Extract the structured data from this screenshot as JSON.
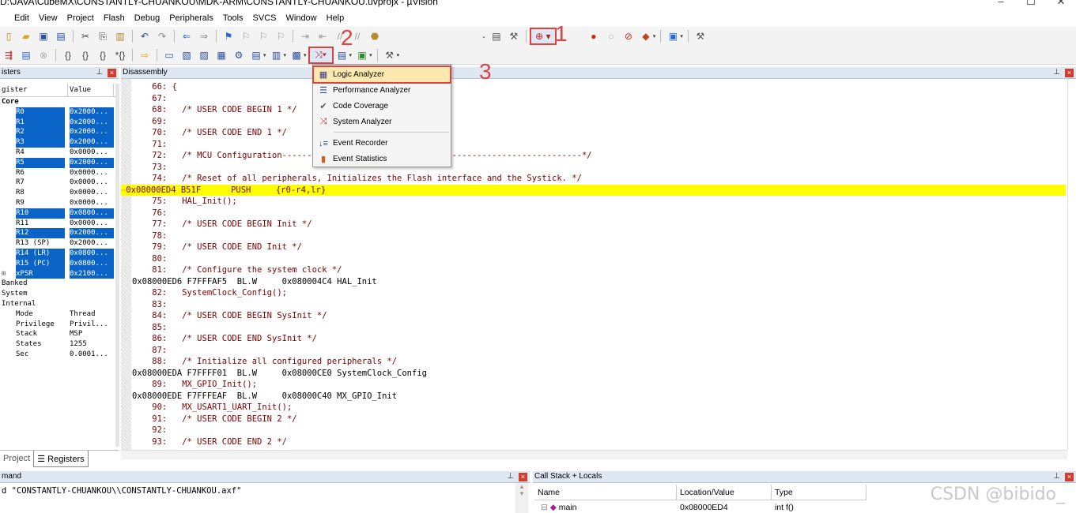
{
  "window": {
    "title": "D:\\JAVA\\CubeMX\\CONSTANTLY-CHUANKOU\\MDK-ARM\\CONSTANTLY-CHUANKOU.uvprojx - µVision",
    "minimize": "–",
    "maximize": "☐",
    "close": "✕"
  },
  "menu": [
    "Edit",
    "View",
    "Project",
    "Flash",
    "Debug",
    "Peripherals",
    "Tools",
    "SVCS",
    "Window",
    "Help"
  ],
  "annotations": {
    "one": "1",
    "two": "2",
    "three": "3"
  },
  "colors": {
    "highlight": "#ffff00",
    "selection": "#0a64c8",
    "annotation": "#e04040"
  },
  "registers_panel": {
    "title": "isters",
    "col_register": "gister",
    "col_value": "Value",
    "rows": [
      {
        "name": "Core",
        "value": "",
        "selected": false,
        "indent": 0,
        "bold": true
      },
      {
        "name": "R0",
        "value": "0x2000...",
        "selected": true,
        "indent": 1
      },
      {
        "name": "R1",
        "value": "0x2000...",
        "selected": true,
        "indent": 1
      },
      {
        "name": "R2",
        "value": "0x2000...",
        "selected": true,
        "indent": 1
      },
      {
        "name": "R3",
        "value": "0x2000...",
        "selected": true,
        "indent": 1
      },
      {
        "name": "R4",
        "value": "0x0000...",
        "selected": false,
        "indent": 1
      },
      {
        "name": "R5",
        "value": "0x2000...",
        "selected": true,
        "indent": 1
      },
      {
        "name": "R6",
        "value": "0x0000...",
        "selected": false,
        "indent": 1
      },
      {
        "name": "R7",
        "value": "0x0000...",
        "selected": false,
        "indent": 1
      },
      {
        "name": "R8",
        "value": "0x0000...",
        "selected": false,
        "indent": 1
      },
      {
        "name": "R9",
        "value": "0x0000...",
        "selected": false,
        "indent": 1
      },
      {
        "name": "R10",
        "value": "0x0800...",
        "selected": true,
        "indent": 1
      },
      {
        "name": "R11",
        "value": "0x0000...",
        "selected": false,
        "indent": 1
      },
      {
        "name": "R12",
        "value": "0x2000...",
        "selected": true,
        "indent": 1
      },
      {
        "name": "R13 (SP)",
        "value": "0x2000...",
        "selected": false,
        "indent": 1
      },
      {
        "name": "R14 (LR)",
        "value": "0x0800...",
        "selected": true,
        "indent": 1
      },
      {
        "name": "R15 (PC)",
        "value": "0x0800...",
        "selected": true,
        "indent": 1
      },
      {
        "name": "xPSR",
        "value": "0x2100...",
        "selected": true,
        "indent": 1,
        "expander": "⊞"
      },
      {
        "name": "Banked",
        "value": "",
        "selected": false,
        "indent": 0
      },
      {
        "name": "System",
        "value": "",
        "selected": false,
        "indent": 0
      },
      {
        "name": "Internal",
        "value": "",
        "selected": false,
        "indent": 0
      },
      {
        "name": "Mode",
        "value": "Thread",
        "selected": false,
        "indent": 1
      },
      {
        "name": "Privilege",
        "value": "Privil...",
        "selected": false,
        "indent": 1
      },
      {
        "name": "Stack",
        "value": "MSP",
        "selected": false,
        "indent": 1
      },
      {
        "name": "States",
        "value": "1255",
        "selected": false,
        "indent": 1
      },
      {
        "name": "Sec",
        "value": "0.0001...",
        "selected": false,
        "indent": 1
      }
    ],
    "tab_project": "Project",
    "tab_registers": "Registers"
  },
  "disassembly": {
    "title": "Disassembly",
    "lines": [
      {
        "kind": "src",
        "text": "    66: {"
      },
      {
        "kind": "src",
        "text": "    67: "
      },
      {
        "kind": "src",
        "text": "    68:   /* USER CODE BEGIN 1 */"
      },
      {
        "kind": "src",
        "text": "    69: "
      },
      {
        "kind": "src",
        "text": "    70:   /* USER CODE END 1 */"
      },
      {
        "kind": "src",
        "text": "    71: "
      },
      {
        "kind": "src",
        "text": "    72:   /* MCU Configuration------------------------------------------------------------*/"
      },
      {
        "kind": "src",
        "text": "    73: "
      },
      {
        "kind": "src",
        "text": "    74:   /* Reset of all peripherals, Initializes the Flash interface and the Systick. */"
      },
      {
        "kind": "cur",
        "text": "0x08000ED4 B51F      PUSH     {r0-r4,lr}"
      },
      {
        "kind": "src",
        "text": "    75:   HAL_Init();"
      },
      {
        "kind": "src",
        "text": "    76: "
      },
      {
        "kind": "src",
        "text": "    77:   /* USER CODE BEGIN Init */"
      },
      {
        "kind": "src",
        "text": "    78: "
      },
      {
        "kind": "src",
        "text": "    79:   /* USER CODE END Init */"
      },
      {
        "kind": "src",
        "text": "    80: "
      },
      {
        "kind": "src",
        "text": "    81:   /* Configure the system clock */"
      },
      {
        "kind": "asm",
        "text": "0x08000ED6 F7FFFAF5  BL.W     0x080004C4 HAL_Init"
      },
      {
        "kind": "src",
        "text": "    82:   SystemClock_Config();"
      },
      {
        "kind": "src",
        "text": "    83: "
      },
      {
        "kind": "src",
        "text": "    84:   /* USER CODE BEGIN SysInit */"
      },
      {
        "kind": "src",
        "text": "    85: "
      },
      {
        "kind": "src",
        "text": "    86:   /* USER CODE END SysInit */"
      },
      {
        "kind": "src",
        "text": "    87: "
      },
      {
        "kind": "src",
        "text": "    88:   /* Initialize all configured peripherals */"
      },
      {
        "kind": "asm",
        "text": "0x08000EDA F7FFFF01  BL.W     0x08000CE0 SystemClock_Config"
      },
      {
        "kind": "src",
        "text": "    89:   MX_GPIO_Init();"
      },
      {
        "kind": "asm",
        "text": "0x08000EDE F7FFFEAF  BL.W     0x08000C40 MX_GPIO_Init"
      },
      {
        "kind": "src",
        "text": "    90:   MX_USART1_UART_Init();"
      },
      {
        "kind": "src",
        "text": "    91:   /* USER CODE BEGIN 2 */"
      },
      {
        "kind": "src",
        "text": "    92: "
      },
      {
        "kind": "src",
        "text": "    93:   /* USER CODE END 2 */"
      }
    ]
  },
  "analysis_menu": {
    "items": [
      {
        "label": "Logic Analyzer",
        "icon": "logic-analyzer-icon",
        "glyph": "▦",
        "hover": true
      },
      {
        "label": "Performance Analyzer",
        "icon": "performance-analyzer-icon",
        "glyph": "☰",
        "hover": false
      },
      {
        "label": "Code Coverage",
        "icon": "code-coverage-icon",
        "glyph": "✔",
        "hover": false
      },
      {
        "label": "System Analyzer",
        "icon": "system-analyzer-icon",
        "glyph": "⤨",
        "hover": false
      },
      {
        "label": "Event Recorder",
        "icon": "event-recorder-icon",
        "glyph": "↓≡",
        "hover": false
      },
      {
        "label": "Event Statistics",
        "icon": "event-statistics-icon",
        "glyph": "▮",
        "hover": false
      }
    ]
  },
  "command_panel": {
    "title": "mand",
    "text": "d \"CONSTANTLY-CHUANKOU\\\\CONSTANTLY-CHUANKOU.axf\""
  },
  "callstack_panel": {
    "title": "Call Stack + Locals",
    "col_name": "Name",
    "col_location": "Location/Value",
    "col_type": "Type",
    "row": {
      "name": "main",
      "location": "0x08000ED4",
      "type": "int f()"
    }
  },
  "watermark": "CSDN @bibido_"
}
